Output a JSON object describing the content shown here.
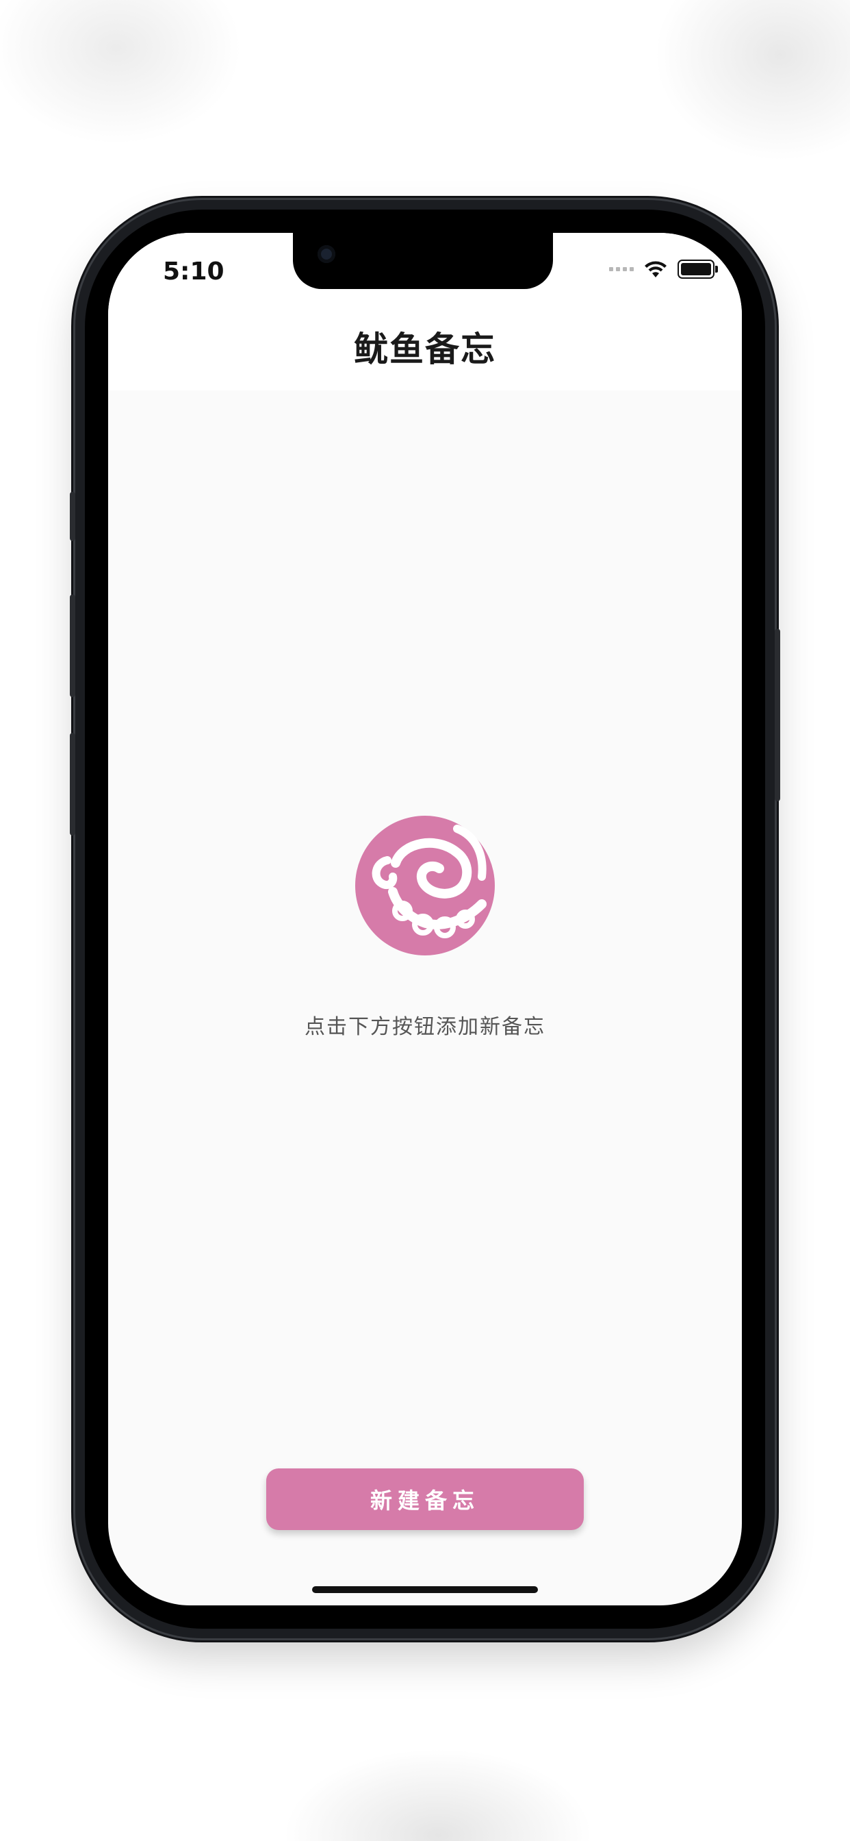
{
  "status_bar": {
    "time": "5:10"
  },
  "nav": {
    "title": "鱿鱼备忘"
  },
  "empty_state": {
    "logo_icon": "octopus-logo-icon",
    "hint": "点击下方按钮添加新备忘"
  },
  "actions": {
    "new_button_label": "新建备忘"
  },
  "colors": {
    "accent": "#d67ba9",
    "background": "#fafafa",
    "title_text": "#1a1a1a",
    "hint_text": "#555555"
  }
}
